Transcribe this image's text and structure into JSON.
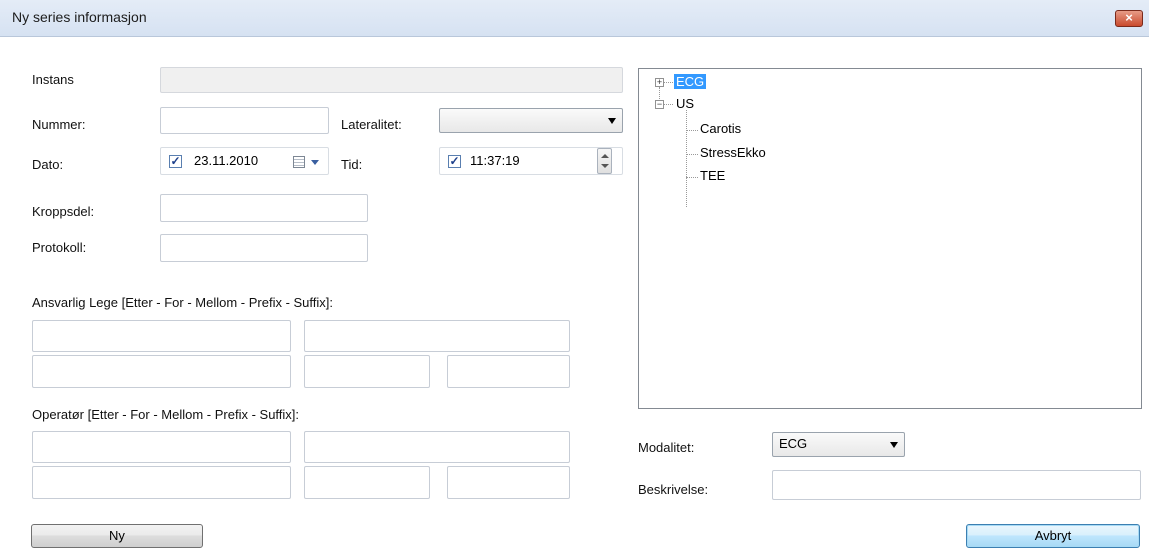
{
  "window": {
    "title": "Ny series informasjon",
    "close_icon": "close-icon"
  },
  "form": {
    "instans_label": "Instans",
    "instans_value": "",
    "nummer_label": "Nummer:",
    "nummer_value": "",
    "lateralitet_label": "Lateralitet:",
    "lateralitet_value": "",
    "dato_label": "Dato:",
    "dato_checked": true,
    "dato_value": "23.11.2010",
    "tid_label": "Tid:",
    "tid_checked": true,
    "tid_value": "11:37:19",
    "kroppsdel_label": "Kroppsdel:",
    "kroppsdel_value": "",
    "protokoll_label": "Protokoll:",
    "protokoll_value": "",
    "ansvarlig_label": "Ansvarlig Lege [Etter - For - Mellom - Prefix - Suffix]:",
    "operator_label": "Operatør [Etter - For - Mellom - Prefix - Suffix]:"
  },
  "tree": {
    "items": [
      {
        "label": "ECG",
        "expanded": false,
        "selected": true,
        "children": []
      },
      {
        "label": "US",
        "expanded": true,
        "selected": false,
        "children": [
          "Carotis",
          "StressEkko",
          "TEE"
        ]
      }
    ],
    "expander_collapsed": "+",
    "expander_expanded": "−"
  },
  "right": {
    "modalitet_label": "Modalitet:",
    "modalitet_value": "ECG",
    "beskrivelse_label": "Beskrivelse:",
    "beskrivelse_value": ""
  },
  "buttons": {
    "ny": "Ny",
    "avbryt": "Avbryt"
  },
  "checkmark": "✓"
}
